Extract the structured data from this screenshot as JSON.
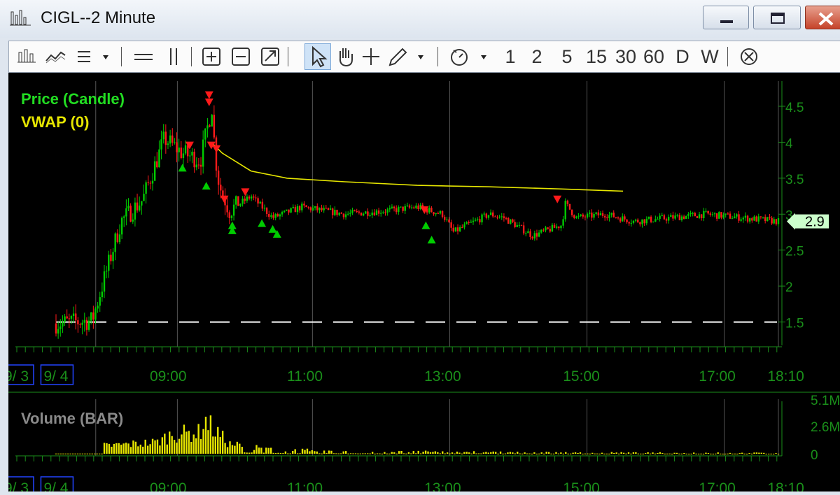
{
  "window": {
    "title": "CIGL--2 Minute"
  },
  "toolbar": {
    "intervals": [
      "1",
      "2",
      "5",
      "15",
      "30",
      "60",
      "D",
      "W"
    ]
  },
  "colors": {
    "up": "#00cc00",
    "down": "#ff1a1a",
    "vwap": "#e6e600",
    "axis": "#1a8f1a",
    "volume": "#e6e600",
    "price_label": "#ccffcc"
  },
  "chart_data": [
    {
      "type": "candlestick",
      "title": "Price (Candle)",
      "series": [
        {
          "name": "VWAP (0)"
        }
      ],
      "last_price_label": "2.9",
      "y_ticks": [
        "1.5",
        "2",
        "2.5",
        "3",
        "3.5",
        "4",
        "4.5"
      ],
      "ylim": [
        1.35,
        4.85
      ],
      "x_ticks": [
        "9/ 3",
        "9/ 4",
        "09:00",
        "11:00",
        "13:00",
        "15:00",
        "17:00",
        "18:10"
      ],
      "reference_line": 1.5,
      "key_points_time": [
        0,
        0.05,
        0.09,
        0.12,
        0.15,
        0.175,
        0.2,
        0.216,
        0.22,
        0.226,
        0.24,
        0.27,
        0.3,
        0.34,
        0.4,
        0.46,
        0.5,
        0.535,
        0.55,
        0.6,
        0.62,
        0.66,
        0.7,
        0.705,
        0.72,
        0.76,
        0.8,
        0.85,
        0.9,
        1.0
      ],
      "key_points_price": [
        1.48,
        1.52,
        2.9,
        3.2,
        4.05,
        3.85,
        3.75,
        4.5,
        3.85,
        3.4,
        3.05,
        3.25,
        2.95,
        3.1,
        3.0,
        3.05,
        3.1,
        3.0,
        2.75,
        3.0,
        2.95,
        2.7,
        2.85,
        3.15,
        2.95,
        3.0,
        2.9,
        2.95,
        3.0,
        2.9
      ],
      "vwap_time": [
        0.215,
        0.23,
        0.27,
        0.32,
        0.4,
        0.5,
        0.6,
        0.7,
        0.785
      ],
      "vwap_price": [
        4.0,
        3.85,
        3.6,
        3.5,
        3.45,
        3.4,
        3.38,
        3.35,
        3.32
      ],
      "sell_signals": [
        [
          0.212,
          4.65
        ],
        [
          0.212,
          4.55
        ],
        [
          0.185,
          3.95
        ],
        [
          0.215,
          3.95
        ],
        [
          0.222,
          3.9
        ],
        [
          0.233,
          3.2
        ],
        [
          0.262,
          3.3
        ],
        [
          0.51,
          3.05
        ],
        [
          0.694,
          3.2
        ]
      ],
      "buy_signals": [
        [
          0.175,
          3.65
        ],
        [
          0.208,
          3.4
        ],
        [
          0.244,
          2.85
        ],
        [
          0.244,
          2.78
        ],
        [
          0.285,
          2.88
        ],
        [
          0.3,
          2.8
        ],
        [
          0.306,
          2.73
        ],
        [
          0.512,
          2.85
        ],
        [
          0.52,
          2.65
        ]
      ]
    },
    {
      "type": "bar",
      "title": "Volume (BAR)",
      "y_ticks": [
        "0",
        "2.6M",
        "5.1M"
      ],
      "ylim": [
        0,
        5.1
      ],
      "unit": "M",
      "peaks_time": [
        0.07,
        0.14,
        0.16,
        0.2,
        0.205,
        0.21,
        0.24,
        0.3,
        0.4,
        0.45,
        0.5,
        0.7,
        0.95
      ],
      "peaks_value": [
        0.9,
        1.3,
        2.2,
        2.4,
        4.0,
        3.4,
        1.1,
        0.5,
        0.3,
        0.2,
        0.25,
        0.15,
        0.1
      ]
    }
  ]
}
